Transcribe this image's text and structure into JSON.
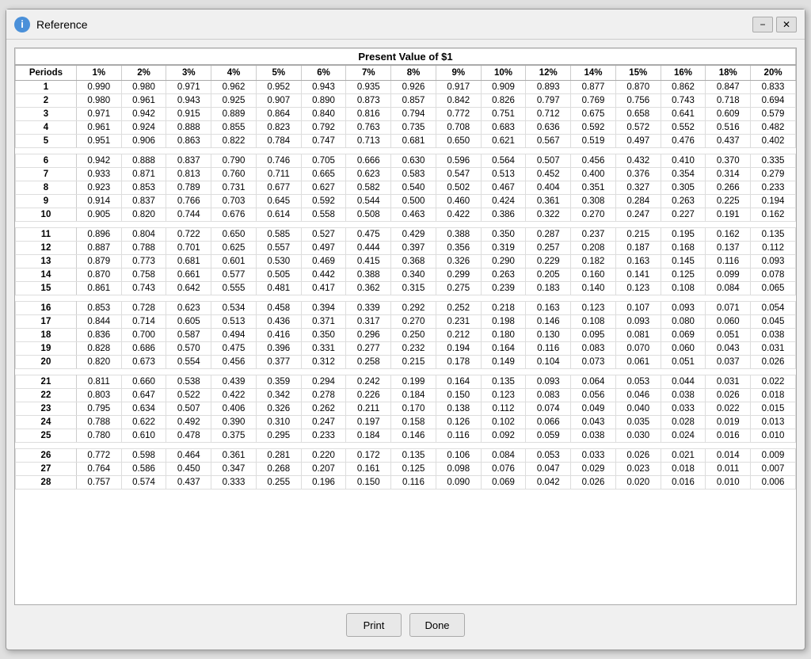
{
  "window": {
    "title": "Reference",
    "minimize_label": "−",
    "close_label": "✕"
  },
  "table": {
    "title": "Present Value of $1",
    "columns": [
      "Periods",
      "1%",
      "2%",
      "3%",
      "4%",
      "5%",
      "6%",
      "7%",
      "8%",
      "9%",
      "10%",
      "12%",
      "14%",
      "15%",
      "16%",
      "18%",
      "20%"
    ],
    "rows": [
      [
        1,
        0.99,
        0.98,
        0.971,
        0.962,
        0.952,
        0.943,
        0.935,
        0.926,
        0.917,
        0.909,
        0.893,
        0.877,
        0.87,
        0.862,
        0.847,
        0.833
      ],
      [
        2,
        0.98,
        0.961,
        0.943,
        0.925,
        0.907,
        0.89,
        0.873,
        0.857,
        0.842,
        0.826,
        0.797,
        0.769,
        0.756,
        0.743,
        0.718,
        0.694
      ],
      [
        3,
        0.971,
        0.942,
        0.915,
        0.889,
        0.864,
        0.84,
        0.816,
        0.794,
        0.772,
        0.751,
        0.712,
        0.675,
        0.658,
        0.641,
        0.609,
        0.579
      ],
      [
        4,
        0.961,
        0.924,
        0.888,
        0.855,
        0.823,
        0.792,
        0.763,
        0.735,
        0.708,
        0.683,
        0.636,
        0.592,
        0.572,
        0.552,
        0.516,
        0.482
      ],
      [
        5,
        0.951,
        0.906,
        0.863,
        0.822,
        0.784,
        0.747,
        0.713,
        0.681,
        0.65,
        0.621,
        0.567,
        0.519,
        0.497,
        0.476,
        0.437,
        0.402
      ],
      [
        6,
        0.942,
        0.888,
        0.837,
        0.79,
        0.746,
        0.705,
        0.666,
        0.63,
        0.596,
        0.564,
        0.507,
        0.456,
        0.432,
        0.41,
        0.37,
        0.335
      ],
      [
        7,
        0.933,
        0.871,
        0.813,
        0.76,
        0.711,
        0.665,
        0.623,
        0.583,
        0.547,
        0.513,
        0.452,
        0.4,
        0.376,
        0.354,
        0.314,
        0.279
      ],
      [
        8,
        0.923,
        0.853,
        0.789,
        0.731,
        0.677,
        0.627,
        0.582,
        0.54,
        0.502,
        0.467,
        0.404,
        0.351,
        0.327,
        0.305,
        0.266,
        0.233
      ],
      [
        9,
        0.914,
        0.837,
        0.766,
        0.703,
        0.645,
        0.592,
        0.544,
        0.5,
        0.46,
        0.424,
        0.361,
        0.308,
        0.284,
        0.263,
        0.225,
        0.194
      ],
      [
        10,
        0.905,
        0.82,
        0.744,
        0.676,
        0.614,
        0.558,
        0.508,
        0.463,
        0.422,
        0.386,
        0.322,
        0.27,
        0.247,
        0.227,
        0.191,
        0.162
      ],
      [
        11,
        0.896,
        0.804,
        0.722,
        0.65,
        0.585,
        0.527,
        0.475,
        0.429,
        0.388,
        0.35,
        0.287,
        0.237,
        0.215,
        0.195,
        0.162,
        0.135
      ],
      [
        12,
        0.887,
        0.788,
        0.701,
        0.625,
        0.557,
        0.497,
        0.444,
        0.397,
        0.356,
        0.319,
        0.257,
        0.208,
        0.187,
        0.168,
        0.137,
        0.112
      ],
      [
        13,
        0.879,
        0.773,
        0.681,
        0.601,
        0.53,
        0.469,
        0.415,
        0.368,
        0.326,
        0.29,
        0.229,
        0.182,
        0.163,
        0.145,
        0.116,
        0.093
      ],
      [
        14,
        0.87,
        0.758,
        0.661,
        0.577,
        0.505,
        0.442,
        0.388,
        0.34,
        0.299,
        0.263,
        0.205,
        0.16,
        0.141,
        0.125,
        0.099,
        0.078
      ],
      [
        15,
        0.861,
        0.743,
        0.642,
        0.555,
        0.481,
        0.417,
        0.362,
        0.315,
        0.275,
        0.239,
        0.183,
        0.14,
        0.123,
        0.108,
        0.084,
        0.065
      ],
      [
        16,
        0.853,
        0.728,
        0.623,
        0.534,
        0.458,
        0.394,
        0.339,
        0.292,
        0.252,
        0.218,
        0.163,
        0.123,
        0.107,
        0.093,
        0.071,
        0.054
      ],
      [
        17,
        0.844,
        0.714,
        0.605,
        0.513,
        0.436,
        0.371,
        0.317,
        0.27,
        0.231,
        0.198,
        0.146,
        0.108,
        0.093,
        0.08,
        0.06,
        0.045
      ],
      [
        18,
        0.836,
        0.7,
        0.587,
        0.494,
        0.416,
        0.35,
        0.296,
        0.25,
        0.212,
        0.18,
        0.13,
        0.095,
        0.081,
        0.069,
        0.051,
        0.038
      ],
      [
        19,
        0.828,
        0.686,
        0.57,
        0.475,
        0.396,
        0.331,
        0.277,
        0.232,
        0.194,
        0.164,
        0.116,
        0.083,
        0.07,
        0.06,
        0.043,
        0.031
      ],
      [
        20,
        0.82,
        0.673,
        0.554,
        0.456,
        0.377,
        0.312,
        0.258,
        0.215,
        0.178,
        0.149,
        0.104,
        0.073,
        0.061,
        0.051,
        0.037,
        0.026
      ],
      [
        21,
        0.811,
        0.66,
        0.538,
        0.439,
        0.359,
        0.294,
        0.242,
        0.199,
        0.164,
        0.135,
        0.093,
        0.064,
        0.053,
        0.044,
        0.031,
        0.022
      ],
      [
        22,
        0.803,
        0.647,
        0.522,
        0.422,
        0.342,
        0.278,
        0.226,
        0.184,
        0.15,
        0.123,
        0.083,
        0.056,
        0.046,
        0.038,
        0.026,
        0.018
      ],
      [
        23,
        0.795,
        0.634,
        0.507,
        0.406,
        0.326,
        0.262,
        0.211,
        0.17,
        0.138,
        0.112,
        0.074,
        0.049,
        0.04,
        0.033,
        0.022,
        0.015
      ],
      [
        24,
        0.788,
        0.622,
        0.492,
        0.39,
        0.31,
        0.247,
        0.197,
        0.158,
        0.126,
        0.102,
        0.066,
        0.043,
        0.035,
        0.028,
        0.019,
        0.013
      ],
      [
        25,
        0.78,
        0.61,
        0.478,
        0.375,
        0.295,
        0.233,
        0.184,
        0.146,
        0.116,
        0.092,
        0.059,
        0.038,
        0.03,
        0.024,
        0.016,
        0.01
      ],
      [
        26,
        0.772,
        0.598,
        0.464,
        0.361,
        0.281,
        0.22,
        0.172,
        0.135,
        0.106,
        0.084,
        0.053,
        0.033,
        0.026,
        0.021,
        0.014,
        0.009
      ],
      [
        27,
        0.764,
        0.586,
        0.45,
        0.347,
        0.268,
        0.207,
        0.161,
        0.125,
        0.098,
        0.076,
        0.047,
        0.029,
        0.023,
        0.018,
        0.011,
        0.007
      ],
      [
        28,
        0.757,
        0.574,
        0.437,
        0.333,
        0.255,
        0.196,
        0.15,
        0.116,
        0.09,
        0.069,
        0.042,
        0.026,
        0.02,
        0.016,
        0.01,
        0.006
      ]
    ]
  },
  "buttons": {
    "print_label": "Print",
    "done_label": "Done"
  }
}
